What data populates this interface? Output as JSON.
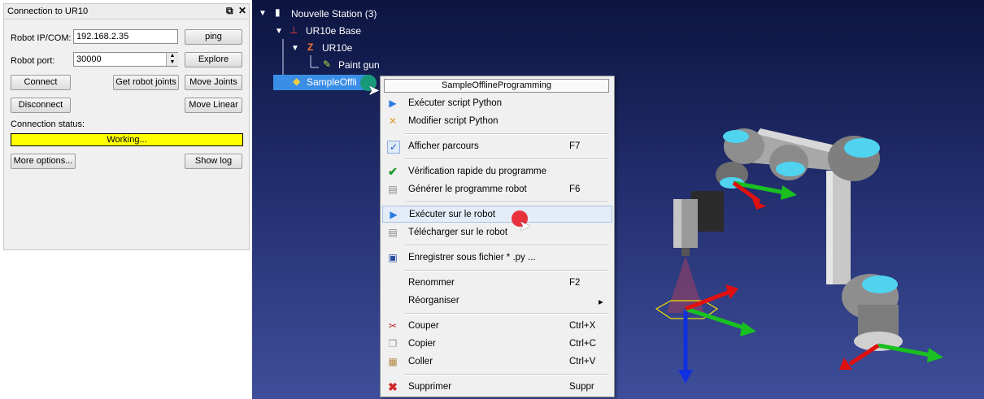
{
  "connection_panel": {
    "title": "Connection to UR10",
    "float_icon": "restore-icon",
    "close_icon": "close-icon",
    "ip_label": "Robot IP/COM:",
    "ip_value": "192.168.2.35",
    "port_label": "Robot port:",
    "port_value": "30000",
    "ping_label": "ping",
    "explore_label": "Explore",
    "connect_label": "Connect",
    "get_joints_label": "Get robot joints",
    "move_joints_label": "Move Joints",
    "disconnect_label": "Disconnect",
    "move_linear_label": "Move Linear",
    "status_label": "Connection status:",
    "status_value": "Working...",
    "status_color": "#ffff00",
    "more_options_label": "More options...",
    "show_log_label": "Show log"
  },
  "tree": {
    "station": "Nouvelle Station (3)",
    "base": "UR10e Base",
    "robot": "UR10e",
    "tool": "Paint gun",
    "program": "SampleOffli"
  },
  "context_menu": {
    "header": "SampleOfflineProgramming",
    "items": [
      {
        "label": "Exécuter script Python",
        "shortcut": "",
        "icon": "play-icon"
      },
      {
        "label": "Modifier script Python",
        "shortcut": "",
        "icon": "edit-script-icon"
      },
      {
        "label": "Afficher parcours",
        "shortcut": "F7",
        "icon": "checkmark-icon"
      },
      {
        "label": "Vérification rapide du programme",
        "shortcut": "",
        "icon": "check-icon"
      },
      {
        "label": "Générer le programme robot",
        "shortcut": "F6",
        "icon": "document-icon"
      },
      {
        "label": "Exécuter sur le robot",
        "shortcut": "",
        "icon": "play-icon"
      },
      {
        "label": "Télécharger sur le robot",
        "shortcut": "",
        "icon": "document-icon"
      },
      {
        "label": "Enregistrer sous fichier * .py ...",
        "shortcut": "",
        "icon": "save-icon"
      },
      {
        "label": "Renommer",
        "shortcut": "F2",
        "icon": ""
      },
      {
        "label": "Réorganiser",
        "shortcut": "",
        "icon": ""
      },
      {
        "label": "Couper",
        "shortcut": "Ctrl+X",
        "icon": "scissors-icon"
      },
      {
        "label": "Copier",
        "shortcut": "Ctrl+C",
        "icon": "copy-icon"
      },
      {
        "label": "Coller",
        "shortcut": "Ctrl+V",
        "icon": "paste-icon"
      },
      {
        "label": "Supprimer",
        "shortcut": "Suppr",
        "icon": "delete-icon"
      }
    ],
    "submenu_arrow": "▸"
  },
  "colors": {
    "highlight": "#e4ecf7",
    "selection": "#3a8ee6",
    "cursor_green": "#169a78",
    "cursor_red": "#e8323c"
  }
}
